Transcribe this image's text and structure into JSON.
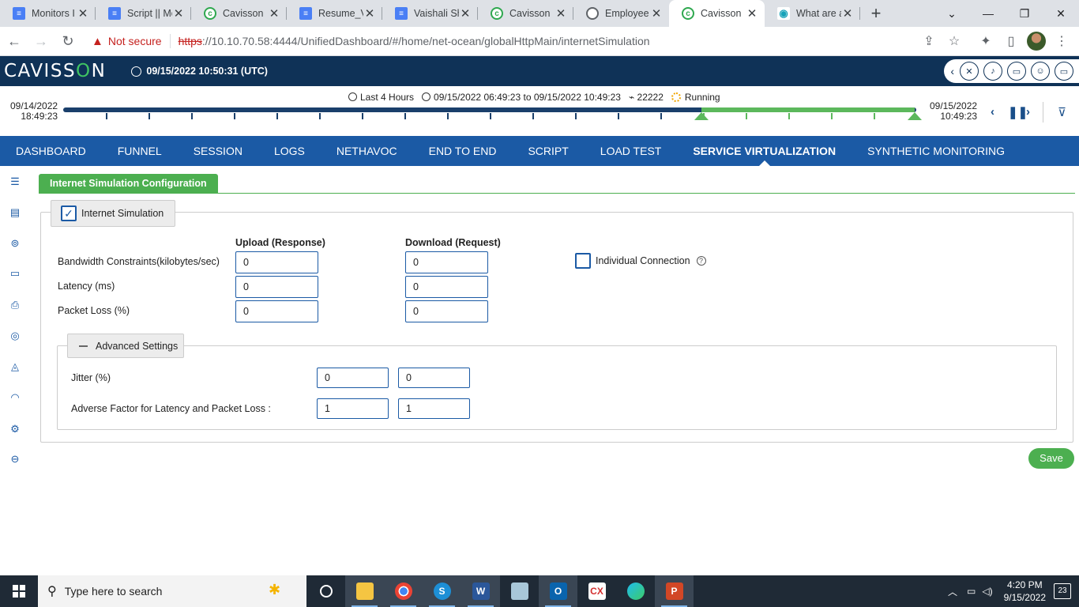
{
  "browser": {
    "tabs": [
      {
        "title": "Monitors I",
        "icon": "docs-icon",
        "active": false
      },
      {
        "title": "Script || Mo",
        "icon": "docs-icon",
        "active": false
      },
      {
        "title": "Cavisson",
        "icon": "cavisson-icon",
        "active": false
      },
      {
        "title": "Resume_V",
        "icon": "docs-icon",
        "active": false
      },
      {
        "title": "Vaishali Sh",
        "icon": "docs-icon",
        "active": false
      },
      {
        "title": "Cavisson",
        "icon": "cavisson-icon",
        "active": false
      },
      {
        "title": "Employee",
        "icon": "globe-icon",
        "active": false
      },
      {
        "title": "Cavisson",
        "icon": "cavisson-icon",
        "active": true
      },
      {
        "title": "What are a",
        "icon": "eye-icon",
        "active": false
      }
    ],
    "not_secure": "Not secure",
    "url_proto": "https",
    "url_host": "://10.10.70.58:4444",
    "url_path": "/UnifiedDashboard/#/home/net-ocean/globalHttpMain/internetSimulation"
  },
  "header": {
    "logo_left": "CAVISS",
    "logo_o": "O",
    "logo_right": "N",
    "datetime": "09/15/2022 10:50:31 (UTC)"
  },
  "timeline": {
    "range_label": "Last 4 Hours",
    "period": "09/15/2022 06:49:23 to 09/15/2022 10:49:23",
    "test_id": "22222",
    "status": "Running",
    "start_date": "09/14/2022",
    "start_time": "18:49:23",
    "end_date": "09/15/2022",
    "end_time": "10:49:23"
  },
  "nav": {
    "items": [
      "DASHBOARD",
      "FUNNEL",
      "SESSION",
      "LOGS",
      "NETHAVOC",
      "END TO END",
      "SCRIPT",
      "LOAD TEST",
      "SERVICE VIRTUALIZATION",
      "SYNTHETIC MONITORING"
    ],
    "active": "SERVICE VIRTUALIZATION"
  },
  "page": {
    "tab_title": "Internet Simulation Configuration",
    "internet_simulation_label": "Internet Simulation",
    "internet_simulation_checked": true,
    "upload_header": "Upload (Response)",
    "download_header": "Download (Request)",
    "rows": [
      {
        "label": "Bandwidth Constraints(kilobytes/sec)",
        "upload": "0",
        "download": "0"
      },
      {
        "label": "Latency (ms)",
        "upload": "0",
        "download": "0"
      },
      {
        "label": "Packet Loss (%)",
        "upload": "0",
        "download": "0"
      }
    ],
    "individual_connection_label": "Individual Connection",
    "individual_connection_checked": false,
    "advanced_label": "Advanced Settings",
    "jitter_label": "Jitter (%)",
    "jitter_values": [
      "0",
      "0"
    ],
    "adverse_label": "Adverse Factor for Latency and Packet Loss :",
    "adverse_values": [
      "1",
      "1"
    ],
    "save_label": "Save"
  },
  "taskbar": {
    "search_placeholder": "Type here to search",
    "time": "4:20 PM",
    "date": "9/15/2022",
    "notifications": "23"
  }
}
